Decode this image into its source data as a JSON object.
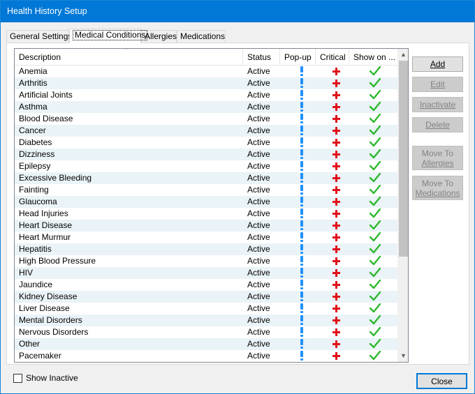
{
  "window": {
    "title": "Health History Setup"
  },
  "tabs": [
    {
      "label": "General Settings"
    },
    {
      "label": "Medical Conditions"
    },
    {
      "label": "Allergies"
    },
    {
      "label": "Medications"
    }
  ],
  "table": {
    "columns": {
      "description": "Description",
      "status": "Status",
      "popup": "Pop-up",
      "critical": "Critical",
      "show_on": "Show on ..."
    },
    "rows": [
      {
        "description": "Anemia",
        "status": "Active"
      },
      {
        "description": "Arthritis",
        "status": "Active"
      },
      {
        "description": "Artificial Joints",
        "status": "Active"
      },
      {
        "description": "Asthma",
        "status": "Active"
      },
      {
        "description": "Blood Disease",
        "status": "Active"
      },
      {
        "description": "Cancer",
        "status": "Active"
      },
      {
        "description": "Diabetes",
        "status": "Active"
      },
      {
        "description": "Dizziness",
        "status": "Active"
      },
      {
        "description": "Epilepsy",
        "status": "Active"
      },
      {
        "description": "Excessive Bleeding",
        "status": "Active"
      },
      {
        "description": "Fainting",
        "status": "Active"
      },
      {
        "description": "Glaucoma",
        "status": "Active"
      },
      {
        "description": "Head Injuries",
        "status": "Active"
      },
      {
        "description": "Heart Disease",
        "status": "Active"
      },
      {
        "description": "Heart Murmur",
        "status": "Active"
      },
      {
        "description": "Hepatitis",
        "status": "Active"
      },
      {
        "description": "High Blood Pressure",
        "status": "Active"
      },
      {
        "description": "HIV",
        "status": "Active"
      },
      {
        "description": "Jaundice",
        "status": "Active"
      },
      {
        "description": "Kidney Disease",
        "status": "Active"
      },
      {
        "description": "Liver Disease",
        "status": "Active"
      },
      {
        "description": "Mental Disorders",
        "status": "Active"
      },
      {
        "description": "Nervous Disorders",
        "status": "Active"
      },
      {
        "description": "Other",
        "status": "Active"
      },
      {
        "description": "Pacemaker",
        "status": "Active"
      }
    ]
  },
  "buttons": {
    "add": {
      "label": "Add"
    },
    "edit": {
      "label": "Edit"
    },
    "inactivate": {
      "label": "Inactivate"
    },
    "delete": {
      "label": "Delete"
    },
    "move_to_allergies": {
      "line1": "Move To",
      "line2": "Allergies"
    },
    "move_to_medications": {
      "line1": "Move To",
      "line2": "Medications"
    },
    "close": {
      "label": "Close"
    }
  },
  "show_inactive": {
    "label": "Show Inactive",
    "checked": false
  },
  "colors": {
    "titlebar": "#0078d7",
    "popup_icon": "#1e90ff",
    "critical_icon": "#e0101a",
    "check_icon": "#2eb82e"
  },
  "icons": {
    "popup": "exclamation-icon",
    "critical": "red-cross-icon",
    "show_on": "check-icon"
  }
}
